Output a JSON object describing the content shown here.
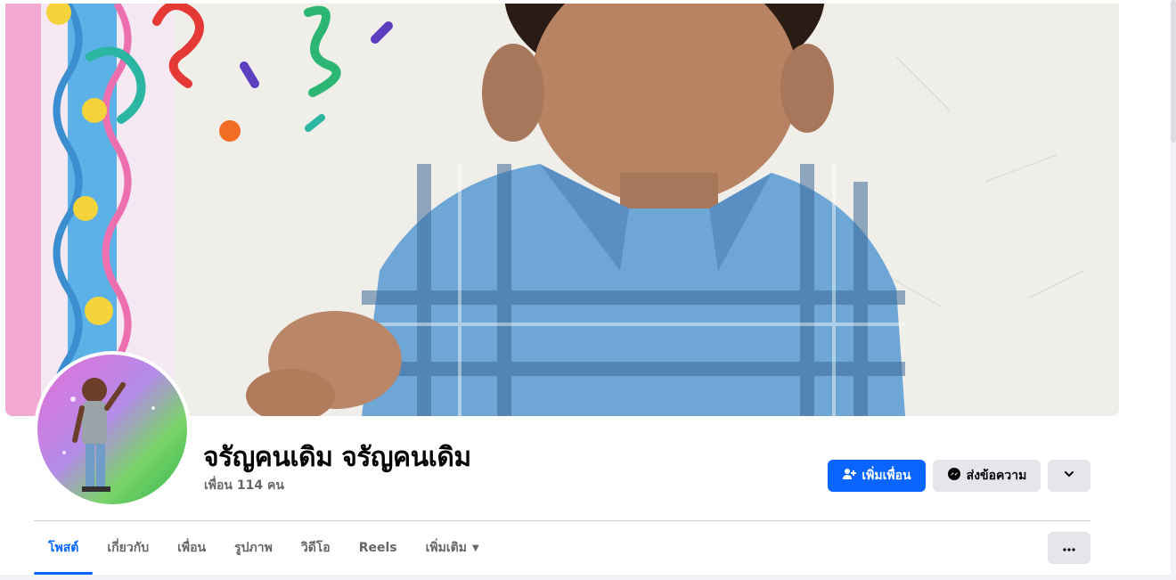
{
  "profile": {
    "name": "จรัญคนเดิม จรัญคนเดิม",
    "friend_count": "เพื่อน 114 คน"
  },
  "actions": {
    "add_friend_label": "เพิ่มเพื่อน",
    "message_label": "ส่งข้อความ",
    "primary_color": "#0866ff"
  },
  "tabs": [
    {
      "label": "โพสต์",
      "active": true
    },
    {
      "label": "เกี่ยวกับ",
      "active": false
    },
    {
      "label": "เพื่อน",
      "active": false
    },
    {
      "label": "รูปภาพ",
      "active": false
    },
    {
      "label": "วิดีโอ",
      "active": false
    },
    {
      "label": "Reels",
      "active": false
    },
    {
      "label": "เพิ่มเติม",
      "active": false
    }
  ],
  "icons": {
    "add_friend": "person-plus-icon",
    "message": "messenger-icon",
    "more_actions": "chevron-down-icon",
    "tab_more": "ellipsis-icon"
  }
}
